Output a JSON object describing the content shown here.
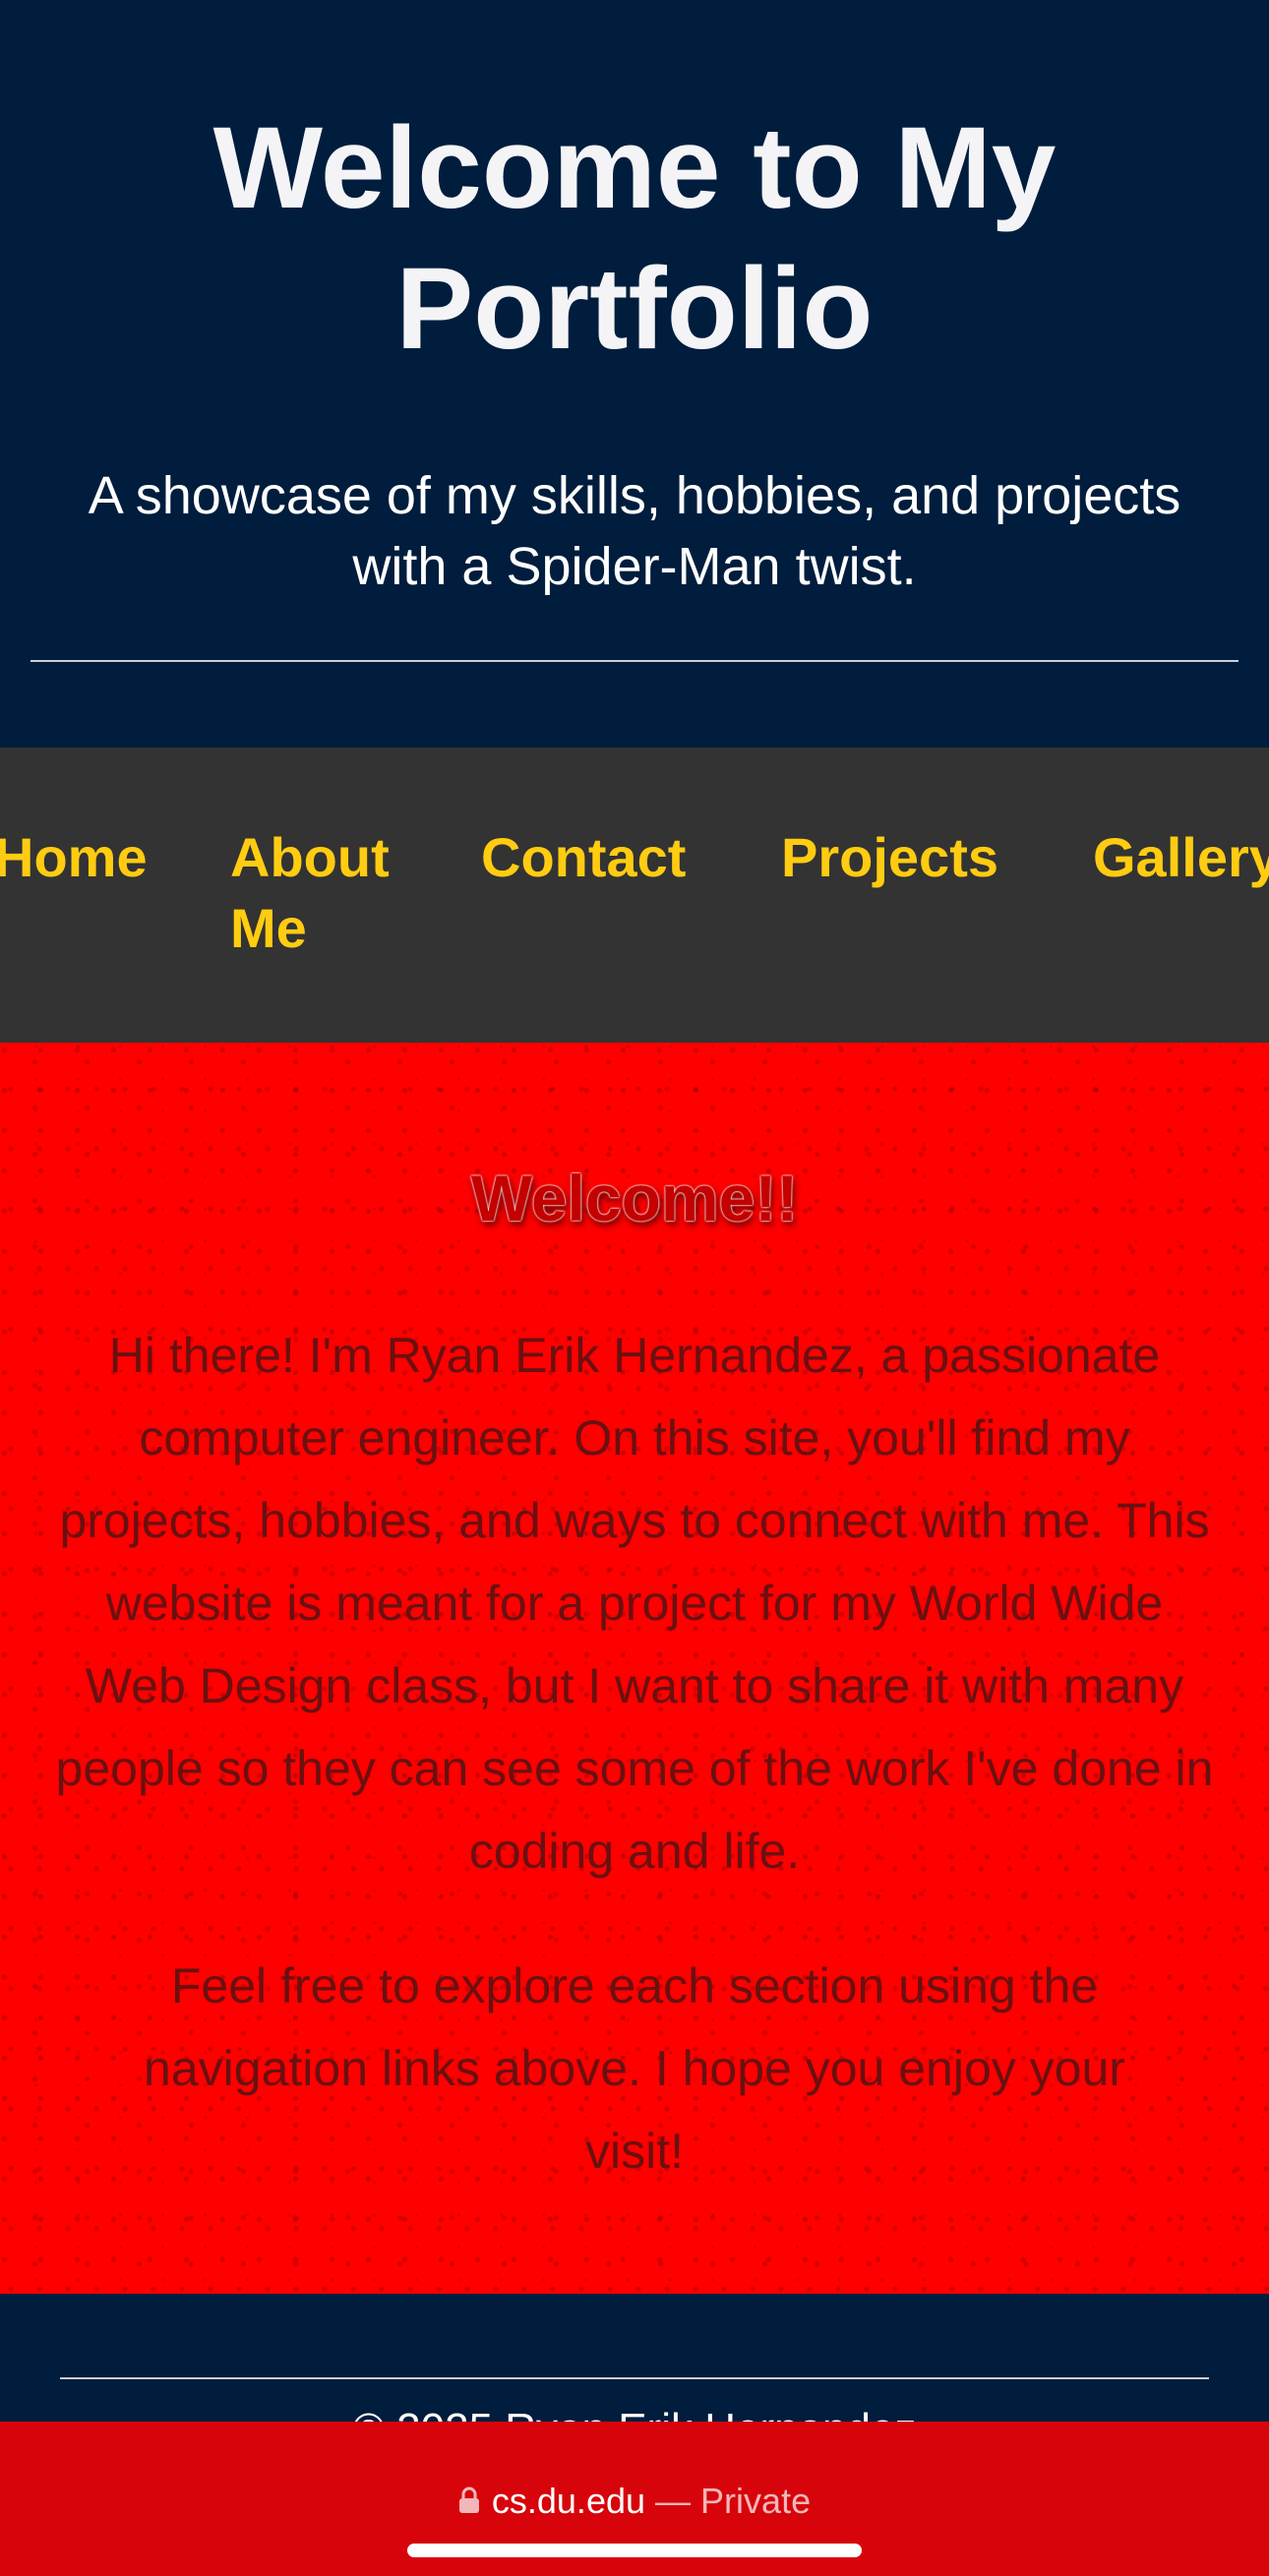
{
  "header": {
    "title": "Welcome to My Portfolio",
    "tagline": "A showcase of my skills, hobbies, and projects with a Spider-Man twist."
  },
  "nav": {
    "items": [
      {
        "label": "Home"
      },
      {
        "label": "About Me"
      },
      {
        "label": "Contact"
      },
      {
        "label": "Projects"
      },
      {
        "label": "Gallery"
      }
    ]
  },
  "main": {
    "heading": "Welcome!!",
    "intro": "Hi there! I'm Ryan Erik Hernandez, a passionate computer engineer. On this site, you'll find my projects, hobbies, and ways to connect with me. This website is meant for a project for my World Wide Web Design class, but I want to share it with many people so they can see some of the work I've done in coding and life.",
    "explore": "Feel free to explore each section using the navigation links above. I hope you enjoy your visit!"
  },
  "footer": {
    "copyright": "© 2025 Ryan Erik Hernandez"
  },
  "browser": {
    "domain": "cs.du.edu",
    "separator": "—",
    "mode": "Private",
    "lock_icon": "lock-icon"
  },
  "colors": {
    "header_bg": "#001d3d",
    "nav_bg": "#333333",
    "nav_link": "#ffcc11",
    "main_bg": "#fe0000",
    "browser_bar": "#d7040b"
  }
}
